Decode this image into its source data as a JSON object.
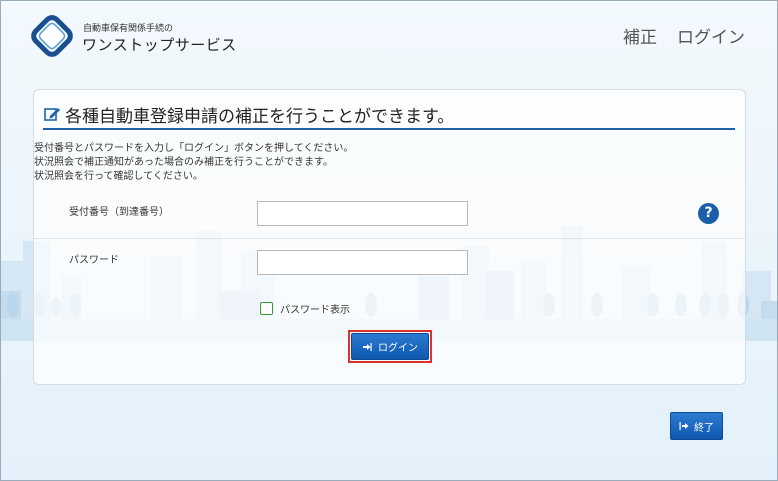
{
  "header": {
    "brand_top": "自動車保有関係手続の",
    "brand_main": "ワンストップサービス",
    "nav": [
      "補正",
      "ログイン"
    ]
  },
  "card": {
    "title": "各種自動車登録申請の補正を行うことができます。",
    "desc": [
      "受付番号とパスワードを入力し「ログイン」ボタンを押してください。",
      "状況照会で補正通知があった場合のみ補正を行うことができます。",
      "状況照会を行って確認してください。"
    ],
    "receipt_label": "受付番号（到達番号）",
    "receipt_value": "",
    "password_label": "パスワード",
    "password_value": "",
    "show_password_label": "パスワード表示",
    "login_button": "ログイン"
  },
  "footer": {
    "end_button": "終了"
  },
  "colors": {
    "accent": "#1f63a9",
    "button": "#1560b8",
    "highlight": "#d9332c"
  }
}
